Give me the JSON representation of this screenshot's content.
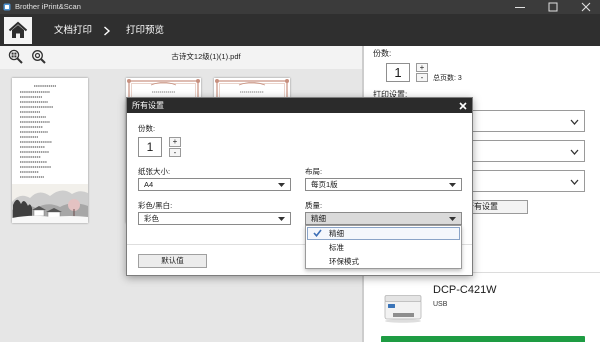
{
  "window": {
    "title": "Brother iPrint&Scan",
    "app_icon": "app-icon",
    "controls": [
      "minimize-icon",
      "maximize-icon",
      "close-icon"
    ]
  },
  "nav": {
    "home_icon": "home-icon",
    "breadcrumb": [
      "文档打印",
      "打印预览"
    ],
    "separator_icon": "chevron-right-icon"
  },
  "preview": {
    "tool_icons": [
      "zoom-fit-icon",
      "zoom-page-icon"
    ],
    "filename": "古诗文12级(1)(1).pdf"
  },
  "side_panel": {
    "copies_label": "份数:",
    "copies_value": "1",
    "increment": "+",
    "decrement": "-",
    "total_pages_label": "总页数:",
    "total_pages_value": "3",
    "print_settings_label": "打印设置:",
    "all_settings_button": "所有设置",
    "printer": {
      "model": "DCP-C421W",
      "connection": "USB",
      "icon": "printer-icon"
    }
  },
  "dialog": {
    "title": "所有设置",
    "close_icon": "close-icon",
    "copies_label": "份数:",
    "copies_value": "1",
    "increment": "+",
    "decrement": "-",
    "paper_size": {
      "label": "纸张大小:",
      "value": "A4"
    },
    "layout": {
      "label": "布局:",
      "value": "每页1版"
    },
    "color_mode": {
      "label": "彩色/黑白:",
      "value": "彩色"
    },
    "quality": {
      "label": "质量:",
      "value": "精细",
      "expanded": true,
      "options": [
        {
          "label": "精细",
          "selected": true
        },
        {
          "label": "标准",
          "selected": false
        },
        {
          "label": "环保模式",
          "selected": false
        }
      ]
    },
    "default_button": "默认值"
  },
  "colors": {
    "title_bar": "#3b3b3b",
    "nav_bar": "#2f2f2f",
    "dialog_title_bar": "#2b2b2b",
    "check_mark": "#3d6fb6",
    "print_button": "#1e9c43"
  }
}
